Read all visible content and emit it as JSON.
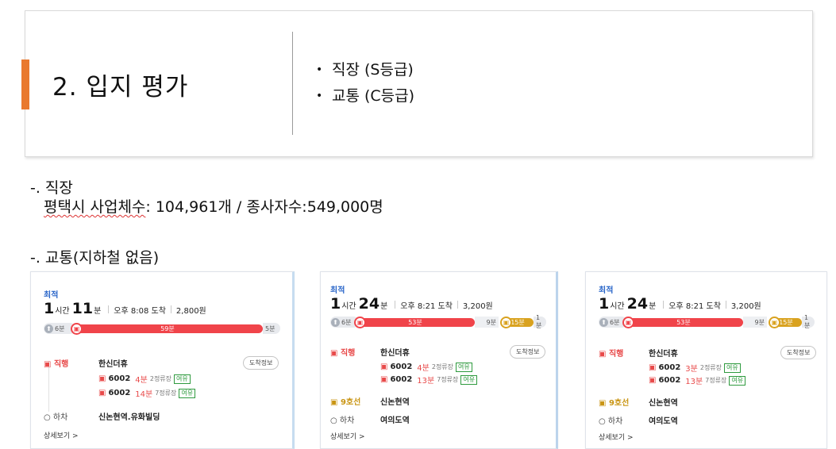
{
  "header": {
    "section_title": "2. 입지 평가",
    "bullets": [
      "직장 (S등급)",
      "교통 (C등급)"
    ]
  },
  "workplace": {
    "heading": "-. 직장",
    "stat_label": "평택시 사업체수",
    "stat_rest": ": 104,961개 / 종사자수:549,000명"
  },
  "transport": {
    "heading": "-. 교통(지하철 없음)"
  },
  "colors": {
    "accent": "#e9792e",
    "bus_red": "#f0444a",
    "subway_yellow": "#d9a21f",
    "best_blue": "#2a66c9",
    "spare_green": "#2e9a3e"
  },
  "routes": [
    {
      "badge": "최적",
      "hours": "1",
      "hours_unit": "시간",
      "mins": "11",
      "mins_unit": "분",
      "arrival": "오후 8:08 도착",
      "fare": "2,800원",
      "walk_start": "6분",
      "bus_time": "59분",
      "walk_end": "5분",
      "step1_label": "직행",
      "step1_stop": "한신더휴",
      "info_button": "도착정보",
      "buses": [
        {
          "num": "6002",
          "min": "4분",
          "stops": "2정류장",
          "tag": "여유"
        },
        {
          "num": "6002",
          "min": "14분",
          "stops": "7정류장",
          "tag": "여유"
        }
      ],
      "exit_label": "하차",
      "exit_stop": "신논현역.유화빌딩",
      "detail": "상세보기 >"
    },
    {
      "badge": "최적",
      "hours": "1",
      "hours_unit": "시간",
      "mins": "24",
      "mins_unit": "분",
      "arrival": "오후 8:21 도착",
      "fare": "3,200원",
      "walk_start": "6분",
      "bus_time": "53분",
      "transfer_walk": "9분",
      "subway_time": "15분",
      "walk_end": "1분",
      "step1_label": "직행",
      "step1_stop": "한신더휴",
      "info_button": "도착정보",
      "buses": [
        {
          "num": "6002",
          "min": "4분",
          "stops": "2정류장",
          "tag": "여유"
        },
        {
          "num": "6002",
          "min": "13분",
          "stops": "7정류장",
          "tag": "여유"
        }
      ],
      "subway_label": "9호선",
      "subway_stop": "신논현역",
      "exit_label": "하차",
      "exit_stop": "여의도역",
      "detail": "상세보기 >"
    },
    {
      "badge": "최적",
      "hours": "1",
      "hours_unit": "시간",
      "mins": "24",
      "mins_unit": "분",
      "arrival": "오후 8:21 도착",
      "fare": "3,200원",
      "walk_start": "6분",
      "bus_time": "53분",
      "transfer_walk": "9분",
      "subway_time": "15분",
      "walk_end": "1분",
      "step1_label": "직행",
      "step1_stop": "한신더휴",
      "info_button": "도착정보",
      "buses": [
        {
          "num": "6002",
          "min": "3분",
          "stops": "2정류장",
          "tag": "여유"
        },
        {
          "num": "6002",
          "min": "13분",
          "stops": "7정류장",
          "tag": "여유"
        }
      ],
      "subway_label": "9호선",
      "subway_stop": "신논현역",
      "exit_label": "하차",
      "exit_stop": "여의도역",
      "detail": "상세보기 >"
    }
  ]
}
